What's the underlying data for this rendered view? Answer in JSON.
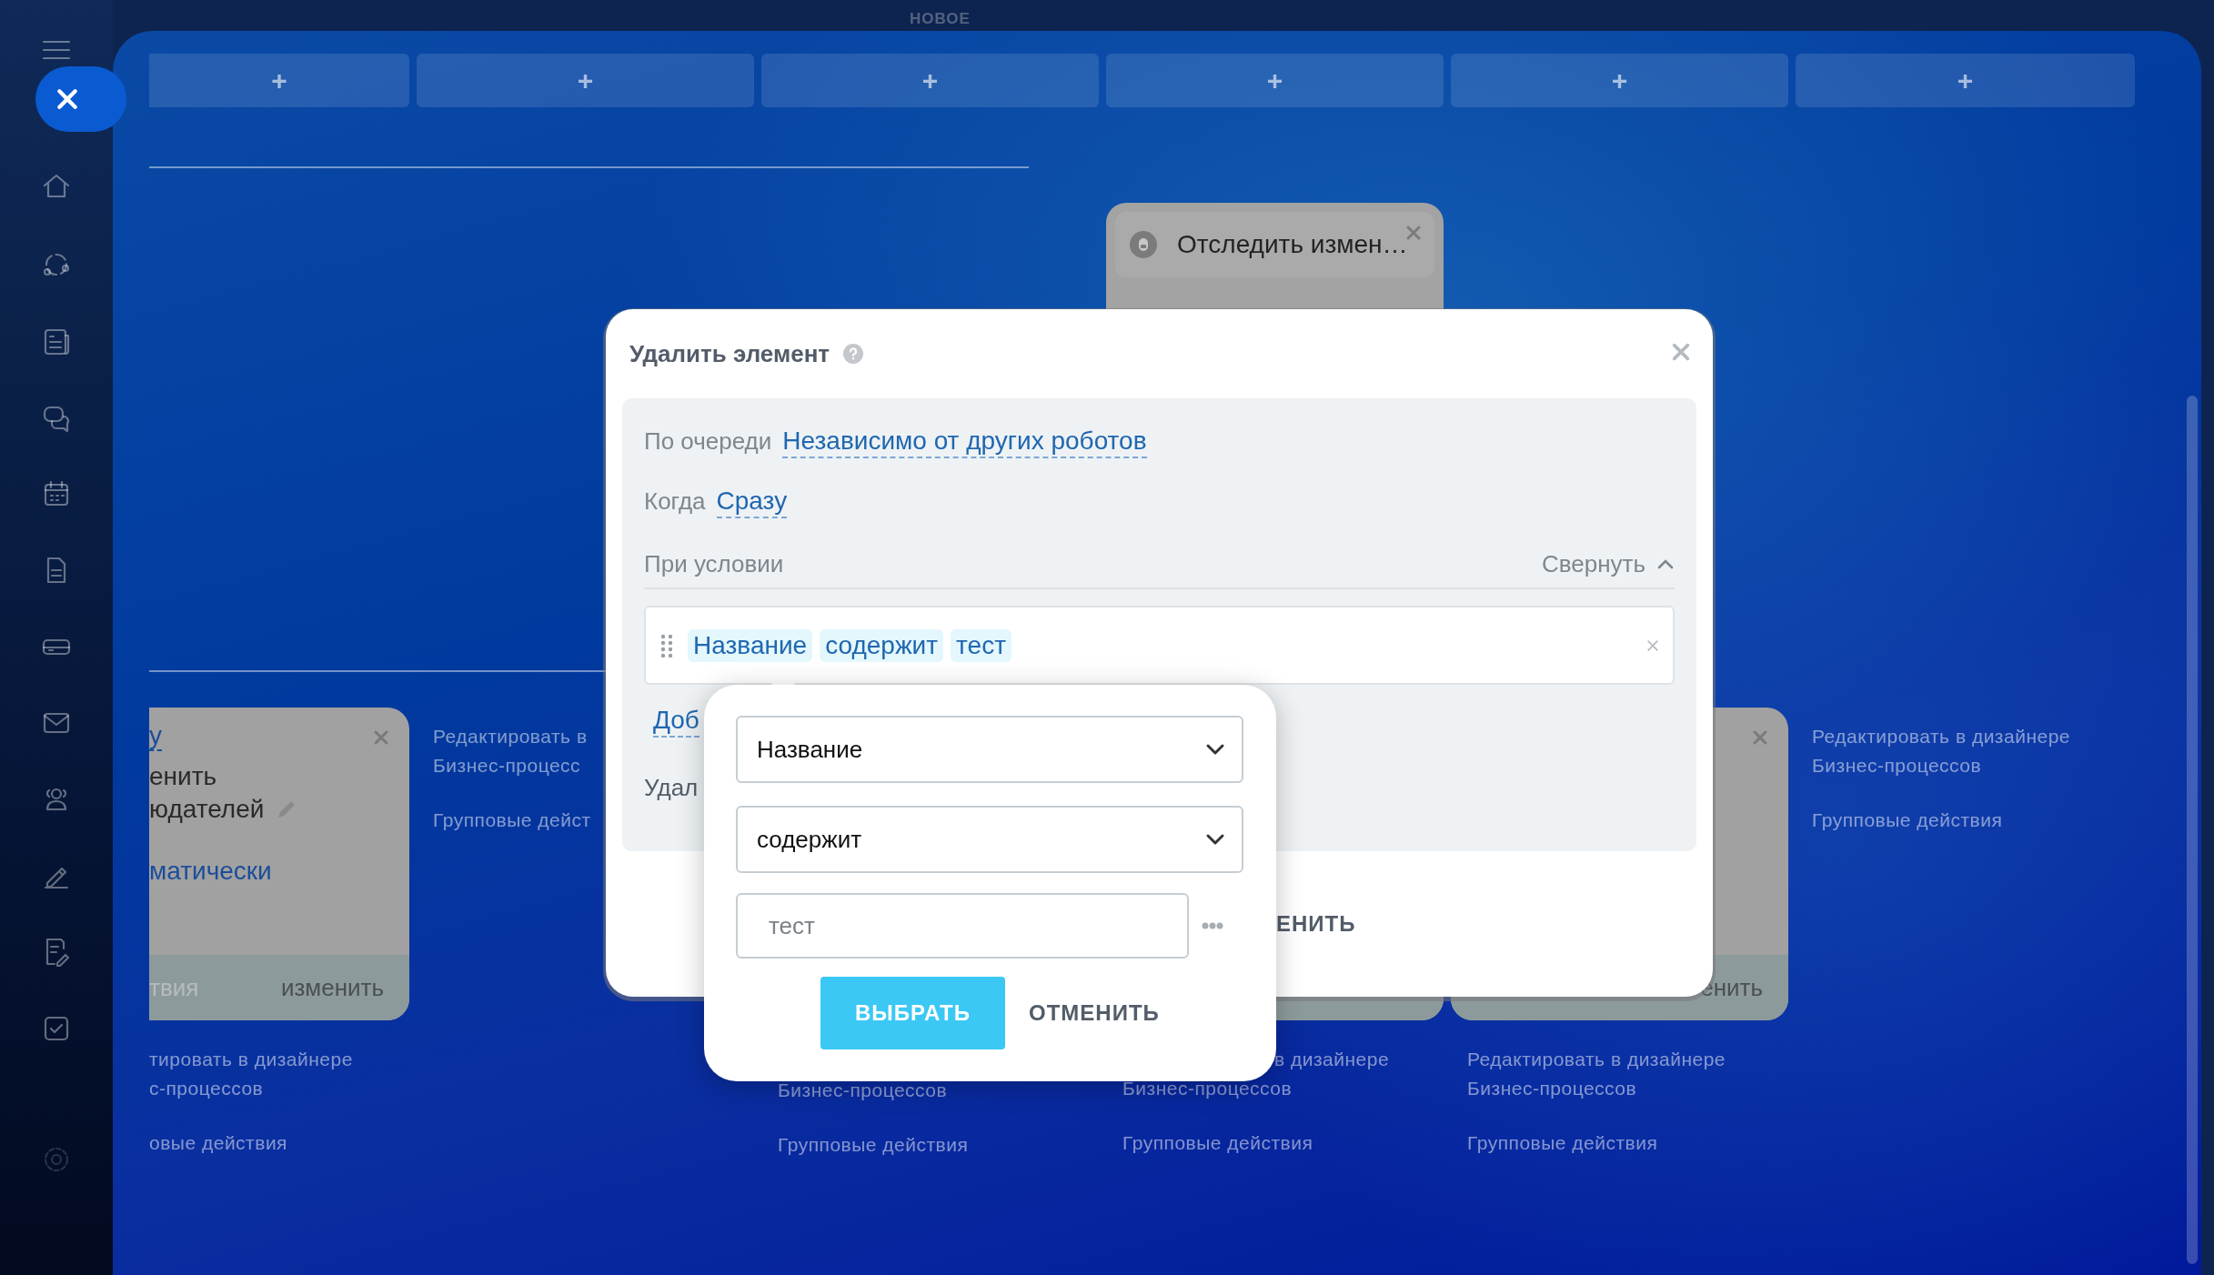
{
  "board": {
    "section_label": "НОВОЕ",
    "add_buttons": [
      "+",
      "+",
      "+",
      "+",
      "+",
      "+"
    ],
    "columns": [
      {
        "card": {
          "kind": "robot",
          "lines": [
            {
              "kind": "link",
              "text": "у"
            },
            {
              "kind": "text",
              "text": "енить"
            },
            {
              "kind": "editable",
              "text": "юдателей"
            },
            {
              "kind": "value",
              "text": "матически"
            }
          ],
          "footer": {
            "copy": "твия",
            "edit": "изменить"
          }
        },
        "links": [
          "тировать в дизайнере\nс-процессов",
          "овые действия"
        ]
      },
      {
        "links_top": [
          "Редактировать в\nБизнес-процесс",
          "Групповые дейст"
        ]
      },
      {
        "links": [
          "Бизнес-процессов",
          "Групповые действия"
        ]
      },
      {
        "top_card": {
          "title": "Отследить измен…"
        },
        "card": {
          "kind": "robot"
        },
        "links": [
          "в дизайнере\nБизнес-процессов",
          "Групповые действия"
        ]
      },
      {
        "card": {
          "kind": "robot",
          "footer": {
            "edit": "енить"
          }
        },
        "links": [
          "Редактировать в дизайнере\nБизнес-процессов",
          "Групповые действия"
        ]
      },
      {
        "links_top": [
          "Редактировать в дизайнере\nБизнес-процессов",
          "Групповые действия"
        ]
      }
    ]
  },
  "modal": {
    "title": "Удалить элемент",
    "fields": [
      {
        "label": "По очереди",
        "value": "Независимо от других роботов"
      },
      {
        "label": "Когда",
        "value": "Сразу"
      }
    ],
    "condition": {
      "label": "При условии",
      "toggle": "Свернуть",
      "expanded": true,
      "chips": [
        "Название",
        "содержит",
        "тест"
      ]
    },
    "add_link": "Доб",
    "delete_label": "Удал",
    "footer_button": "ЕНИТЬ"
  },
  "popup": {
    "field_select": "Название",
    "operator_select": "содержит",
    "value": "тест",
    "ok": "ВЫБРАТЬ",
    "cancel": "ОТМЕНИТЬ"
  }
}
